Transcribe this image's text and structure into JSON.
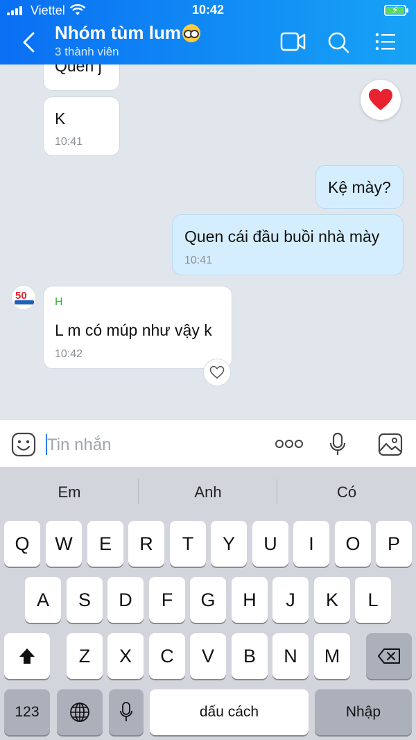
{
  "status_bar": {
    "carrier": "Viettel",
    "time": "10:42"
  },
  "header": {
    "title": "Nhóm tùm lum",
    "subtitle": "3 thành viên"
  },
  "messages": [
    {
      "text": "Quen j"
    },
    {
      "text": "K",
      "time": "10:41"
    },
    {
      "text": "Kệ mày?"
    },
    {
      "text": "Quen cái đầu buồi nhà mày",
      "time": "10:41"
    },
    {
      "sender": "H",
      "text": "L m có múp như vậy k",
      "time": "10:42"
    }
  ],
  "input": {
    "placeholder": "Tin nhắn"
  },
  "keyboard": {
    "suggestions": [
      "Em",
      "Anh",
      "Có"
    ],
    "row1": [
      "Q",
      "W",
      "E",
      "R",
      "T",
      "Y",
      "U",
      "I",
      "O",
      "P"
    ],
    "row2": [
      "A",
      "S",
      "D",
      "F",
      "G",
      "H",
      "J",
      "K",
      "L"
    ],
    "row3": [
      "Z",
      "X",
      "C",
      "V",
      "B",
      "N",
      "M"
    ],
    "numbers_label": "123",
    "space_label": "dấu cách",
    "return_label": "Nhập"
  },
  "colors": {
    "header_start": "#0a6ff3",
    "header_end": "#17a3f6",
    "outgoing_bubble": "#d5eefd",
    "sender_name": "#2bb52b"
  },
  "icons": [
    "back-arrow-icon",
    "video-call-icon",
    "search-icon",
    "list-menu-icon",
    "heart-icon",
    "emoji-icon",
    "more-icon",
    "microphone-icon",
    "image-icon",
    "shift-icon",
    "globe-icon",
    "backspace-icon"
  ]
}
